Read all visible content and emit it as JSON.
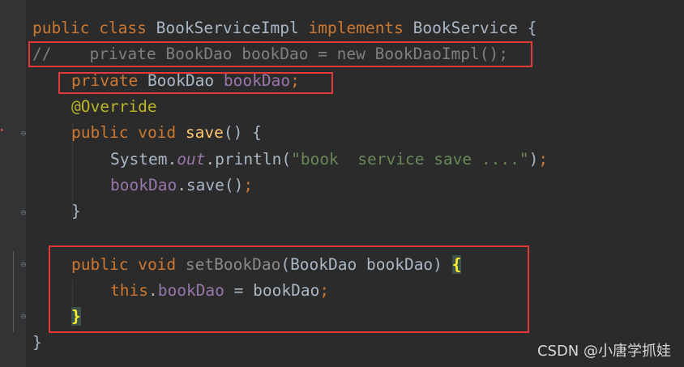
{
  "editor": {
    "lines": {
      "l1": {
        "t1": "public",
        "t2": "class",
        "t3": "BookServiceImpl",
        "t4": "implements",
        "t5": "BookService",
        "t6": "{"
      },
      "l2": {
        "comment": "//    private BookDao bookDao = new BookDaoImpl();"
      },
      "l3": {
        "t1": "private",
        "t2": "BookDao",
        "t3": "bookDao",
        "t4": ";"
      },
      "l4": {
        "ann": "@Override"
      },
      "l5": {
        "t1": "public",
        "t2": "void",
        "t3": "save",
        "t4": "() {"
      },
      "l6": {
        "t1": "System.",
        "t2": "out",
        "t3": ".println(",
        "t4": "\"book  service save ....\"",
        "t5": ")",
        "t6": ";"
      },
      "l7": {
        "t1": "bookDao",
        "t2": ".save()",
        "t3": ";"
      },
      "l8": {
        "t1": "}"
      },
      "l10": {
        "t1": "public",
        "t2": "void",
        "t3": "setBookDao",
        "t4": "(BookDao bookDao) ",
        "t5": "{"
      },
      "l11": {
        "t1": "this",
        "t2": ".",
        "t3": "bookDao",
        "t4": " = bookDao",
        "t5": ";"
      },
      "l12": {
        "t1": "}"
      },
      "l13": {
        "t1": "}"
      }
    }
  },
  "watermark": {
    "text": "CSDN @小唐学抓娃"
  },
  "icons": {
    "fold": "fold-marker-icon",
    "bookmark": "error-marker-icon"
  },
  "colors": {
    "background": "#2b2b2b",
    "keyword": "#cc7832",
    "string": "#6a8759",
    "field": "#9876aa",
    "method": "#ffc66d",
    "highlight_box": "#e13a3a"
  }
}
